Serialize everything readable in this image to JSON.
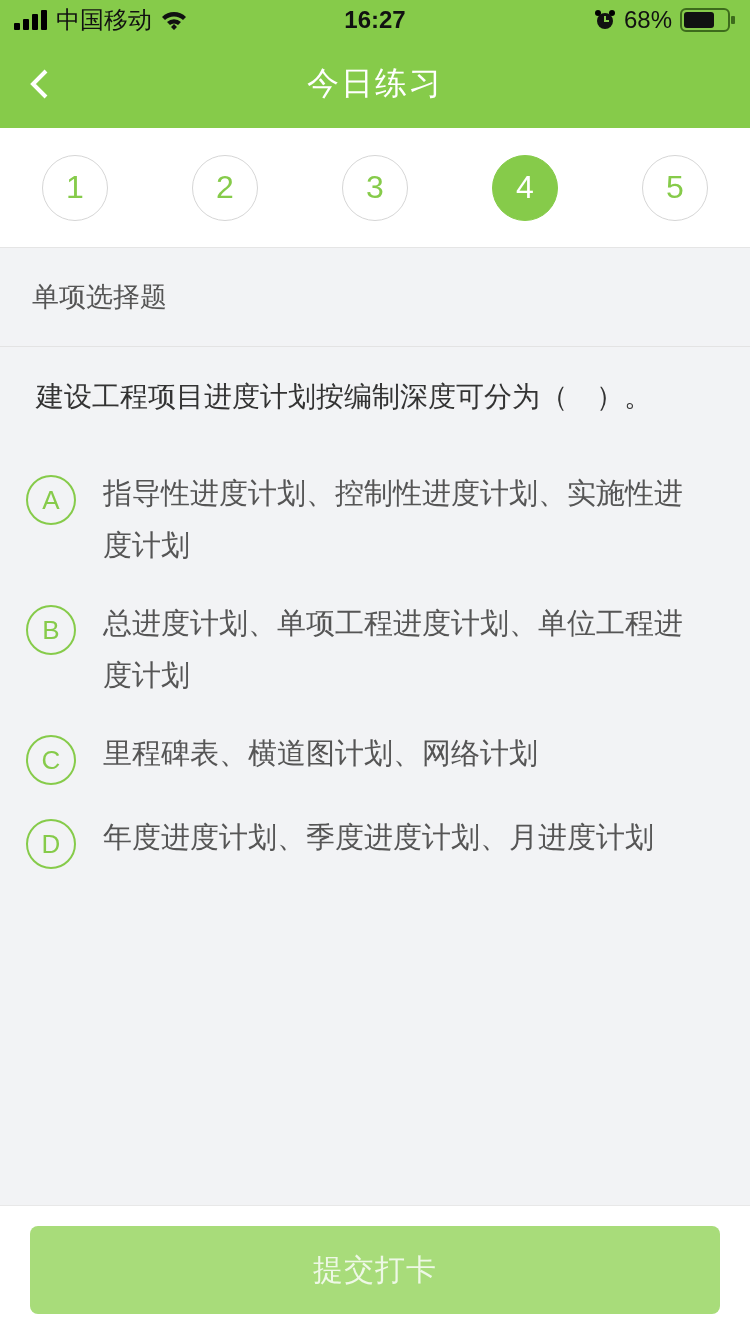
{
  "status_bar": {
    "carrier": "中国移动",
    "time": "16:27",
    "battery": "68%"
  },
  "nav": {
    "title": "今日练习"
  },
  "question_numbers": [
    {
      "label": "1",
      "selected": false
    },
    {
      "label": "2",
      "selected": false
    },
    {
      "label": "3",
      "selected": false
    },
    {
      "label": "4",
      "selected": true
    },
    {
      "label": "5",
      "selected": false
    }
  ],
  "section": "单项选择题",
  "question": "建设工程项目进度计划按编制深度可分为（　）。",
  "options": [
    {
      "letter": "A",
      "text": "指导性进度计划、控制性进度计划、实施性进度计划",
      "selected": false
    },
    {
      "letter": "B",
      "text": "总进度计划、单项工程进度计划、单位工程进度计划",
      "selected": false
    },
    {
      "letter": "C",
      "text": "里程碑表、横道图计划、网络计划",
      "selected": false
    },
    {
      "letter": "D",
      "text": "年度进度计划、季度进度计划、月进度计划",
      "selected": false
    }
  ],
  "submit": {
    "label": "提交打卡",
    "disabled": true
  }
}
